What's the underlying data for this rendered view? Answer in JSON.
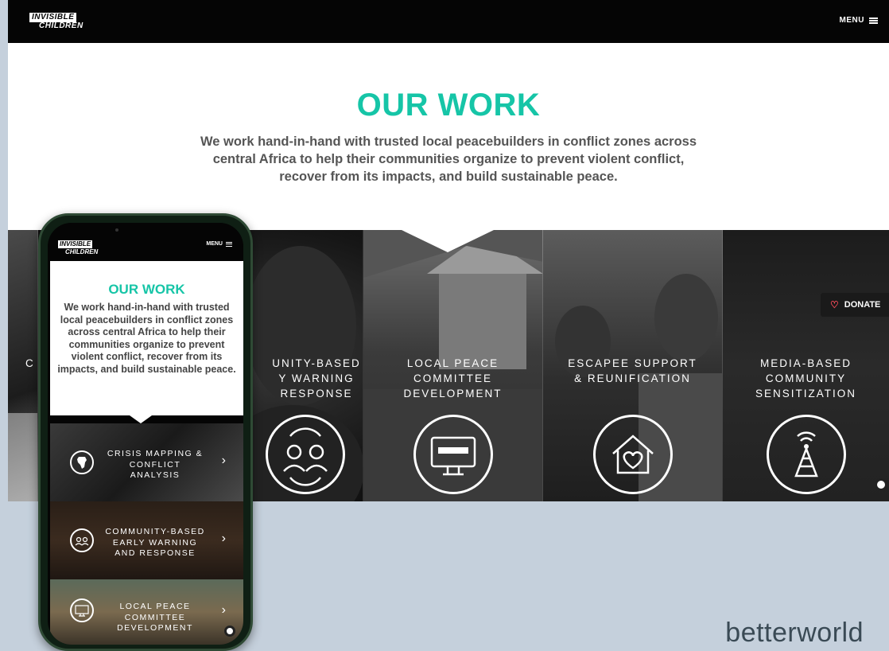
{
  "site": {
    "logo_line1": "INVISIBLE",
    "logo_line2": "CHILDREN",
    "menu_label": "MENU"
  },
  "hero": {
    "title": "OUR WORK",
    "description": "We work hand-in-hand with trusted local peacebuilders in conflict zones across central Africa to help their communities organize to prevent violent conflict, recover from its impacts, and build sustainable peace."
  },
  "panels": [
    {
      "label": "C",
      "icon": "globe-icon"
    },
    {
      "label": "UNITY-BASED\nY WARNING\nRESPONSE",
      "icon": "people-exchange-icon"
    },
    {
      "label": "LOCAL PEACE\nCOMMITTEE\nDEVELOPMENT",
      "icon": "monitor-icon"
    },
    {
      "label": "ESCAPEE SUPPORT\n& REUNIFICATION",
      "icon": "home-heart-icon"
    },
    {
      "label": "MEDIA-BASED\nCOMMUNITY\nSENSITIZATION",
      "icon": "radio-tower-icon"
    }
  ],
  "donate": {
    "label": "DONATE"
  },
  "mobile": {
    "title": "OUR WORK",
    "description": "We work hand-in-hand with trusted local peacebuilders in conflict zones across central Africa to help their communities organize to prevent violent conflict, recover from its impacts, and build sustainable peace.",
    "items": [
      {
        "label": "CRISIS MAPPING &\nCONFLICT\nANALYSIS",
        "icon": "africa-map-icon"
      },
      {
        "label": "COMMUNITY-BASED\nEARLY WARNING\nAND RESPONSE",
        "icon": "people-exchange-icon"
      },
      {
        "label": "LOCAL PEACE\nCOMMITTEE\nDEVELOPMENT",
        "icon": "monitor-icon"
      }
    ]
  },
  "brand": "betterworld",
  "colors": {
    "accent": "#16c5a7",
    "background": "#c5d0dc",
    "nav": "#050505",
    "donate_heart": "#ff4d5a"
  }
}
